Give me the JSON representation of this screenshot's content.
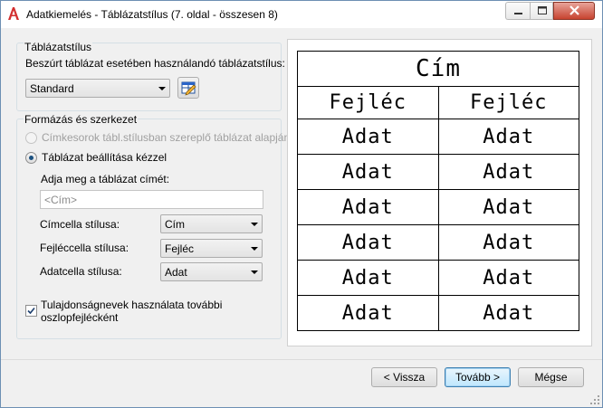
{
  "window": {
    "title": "Adatkiemelés - Táblázatstílus (7. oldal - összesen 8)"
  },
  "table_style_group": {
    "title": "Táblázatstílus",
    "instruction": "Beszúrt táblázat esetében használandó táblázatstílus:",
    "style_select_value": "Standard"
  },
  "format_group": {
    "title": "Formázás és szerkezet",
    "radio_label_style": "Címkesorok tábl.stílusban szereplő táblázat alapján",
    "radio_manual": "Táblázat beállítása kézzel",
    "title_prompt": "Adja meg a táblázat címét:",
    "title_placeholder": "<Cím>",
    "title_cell_label": "Címcella stílusa:",
    "title_cell_value": "Cím",
    "header_cell_label": "Fejléccella stílusa:",
    "header_cell_value": "Fejléc",
    "data_cell_label": "Adatcella stílusa:",
    "data_cell_value": "Adat",
    "property_names_check": "Tulajdonságnevek használata további oszlopfejlécként"
  },
  "preview": {
    "title": "Cím",
    "headers": [
      "Fejléc",
      "Fejléc"
    ],
    "rows": [
      [
        "Adat",
        "Adat"
      ],
      [
        "Adat",
        "Adat"
      ],
      [
        "Adat",
        "Adat"
      ],
      [
        "Adat",
        "Adat"
      ],
      [
        "Adat",
        "Adat"
      ],
      [
        "Adat",
        "Adat"
      ]
    ]
  },
  "buttons": {
    "back": "< Vissza",
    "next": "Tovább >",
    "cancel": "Mégse"
  }
}
